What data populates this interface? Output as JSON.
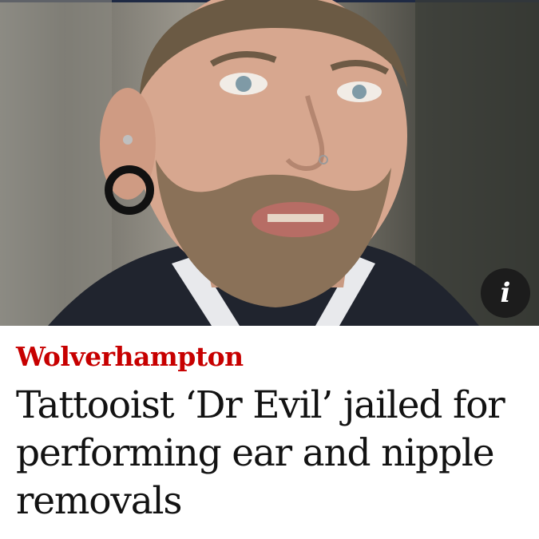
{
  "article": {
    "image": {
      "alt": "Photo of a bearded man with a stretched ear lobe and piercings",
      "info_icon": "info-icon",
      "info_glyph": "i"
    },
    "kicker": "Wolverhampton",
    "headline": "Tattooist ‘Dr Evil’ jailed for performing ear and nipple removals"
  },
  "colors": {
    "kicker": "#c70000",
    "headline": "#121212",
    "info_button": "#1c1c1c"
  }
}
